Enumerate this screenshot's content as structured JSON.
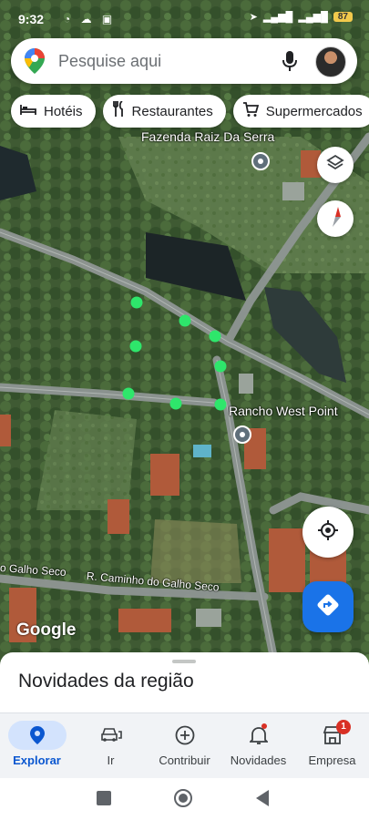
{
  "status_bar": {
    "time": "9:32",
    "battery": "87"
  },
  "search": {
    "placeholder": "Pesquise aqui"
  },
  "chips": [
    {
      "label": "Hotéis",
      "icon": "bed-icon"
    },
    {
      "label": "Restaurantes",
      "icon": "fork-knife-icon"
    },
    {
      "label": "Supermercados",
      "icon": "shopping-cart-icon"
    }
  ],
  "map": {
    "places": [
      {
        "name": "Fazenda Raiz Da Serra"
      },
      {
        "name": "Rancho West Point"
      }
    ],
    "roads": [
      {
        "name": "o Galho Seco"
      },
      {
        "name": "R. Caminho do Galho Seco"
      }
    ],
    "attribution": "Google",
    "marker_color": "#2ee66b"
  },
  "sheet": {
    "title": "Novidades da região"
  },
  "bottom_nav": {
    "items": [
      {
        "label": "Explorar",
        "icon": "explore-pin-icon",
        "active": true
      },
      {
        "label": "Ir",
        "icon": "car-icon"
      },
      {
        "label": "Contribuir",
        "icon": "add-circle-icon"
      },
      {
        "label": "Novidades",
        "icon": "bell-icon"
      },
      {
        "label": "Empresa",
        "icon": "store-icon",
        "badge": "1"
      }
    ]
  },
  "colors": {
    "accent": "#1a73e8",
    "active_nav_bg": "#d3e3fd",
    "badge": "#d93025"
  }
}
